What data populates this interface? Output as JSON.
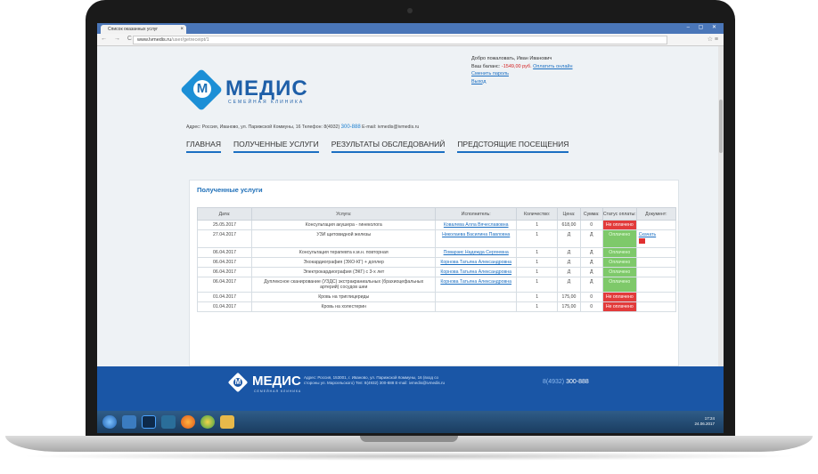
{
  "browser": {
    "tab_title": "Список оказанных услуг",
    "tab_close": "×",
    "url_host": "www.lvmedis.ru",
    "url_path": "/user/getreceipt/1"
  },
  "header": {
    "logo_letter": "М",
    "logo_name": "МЕДИС",
    "logo_sub": "СЕМЕЙНАЯ КЛИНИКА",
    "greeting": "Добро пожаловать, Иван Иванович",
    "balance_label": "Ваш баланс:",
    "balance_value": "-1549,00 руб.",
    "pay_online": "Оплатить онлайн",
    "change_password": "Сменить пароль",
    "logout": "Выход",
    "contact_text": "Адрес: Россия, Иваново, ул. Парижской Коммуны, 16 Телефон: 8(4932)",
    "contact_phone": "300-888",
    "contact_email": "E-mail: ivmedis@ivmedis.ru"
  },
  "menu": {
    "home": "ГЛАВНАЯ",
    "services": "ПОЛУЧЕННЫЕ УСЛУГИ",
    "results": "РЕЗУЛЬТАТЫ ОБСЛЕДОВАНИЙ",
    "visits": "ПРЕДСТОЯЩИЕ ПОСЕЩЕНИЯ"
  },
  "section": {
    "title": "Полученные услуги"
  },
  "table": {
    "headers": [
      "Дата:",
      "Услуга:",
      "Исполнитель:",
      "Количество:",
      "Цена:",
      "Сумма:",
      "Статус оплаты:",
      "Документ:"
    ],
    "rows": [
      {
        "date": "25.05.2017",
        "service": "Консультация акушера - гинеколога",
        "executor": "Ковалева Алла Вячеславовна",
        "qty": "1",
        "price": "618,00",
        "sum": "0",
        "status": "Не оплачено",
        "paid": false,
        "doc": ""
      },
      {
        "date": "27.04.2017",
        "service": "УЗИ щитовидной железы",
        "executor": "Николаева Василина Павловна",
        "qty": "1",
        "price": "Д",
        "sum": "Д",
        "status": "Оплачено",
        "paid": true,
        "doc": "Скачать"
      },
      {
        "date": "06.04.2017",
        "service": "Консультация терапевта к.м.н. повторная",
        "executor": "Поварзис Надежда Сергеевна",
        "qty": "1",
        "price": "Д",
        "sum": "Д",
        "status": "Оплачено",
        "paid": true,
        "doc": ""
      },
      {
        "date": "06.04.2017",
        "service": "Эхокардиография (ЭХО-КГ) + доплер",
        "executor": "Корнова Татьяна Александровна",
        "qty": "1",
        "price": "Д",
        "sum": "Д",
        "status": "Оплачено",
        "paid": true,
        "doc": ""
      },
      {
        "date": "06.04.2017",
        "service": "Электрокардиография (ЭКГ) с 3-х лет",
        "executor": "Корнова Татьяна Александровна",
        "qty": "1",
        "price": "Д",
        "sum": "Д",
        "status": "Оплачено",
        "paid": true,
        "doc": ""
      },
      {
        "date": "06.04.2017",
        "service": "Дуплексное сканирование (УЗДС) экстракраниальных (брахиоцефальных артерий) сосудов шеи",
        "executor": "Корнова Татьяна Александровна",
        "qty": "1",
        "price": "Д",
        "sum": "Д",
        "status": "Оплачено",
        "paid": true,
        "doc": ""
      },
      {
        "date": "01.04.2017",
        "service": "Кровь на триглицериды",
        "executor": "",
        "qty": "1",
        "price": "175,00",
        "sum": "0",
        "status": "Не оплачено",
        "paid": false,
        "doc": ""
      },
      {
        "date": "01.04.2017",
        "service": "Кровь на холестерин",
        "executor": "",
        "qty": "1",
        "price": "175,00",
        "sum": "0",
        "status": "Не оплачено",
        "paid": false,
        "doc": ""
      }
    ]
  },
  "footer": {
    "logo_name": "МЕДИС",
    "logo_sub": "СЕМЕЙНАЯ КЛИНИКА",
    "address": "Адрес: Россия, 153001, г. Иваново, ул. Парижской Коммуны, 16 (вход со стороны ул. Марсельского) Тел: 8(4932) 300-888 E-mail: ivmedis@ivmedis.ru",
    "phone_code": "8(4932)",
    "phone": "300-888"
  },
  "taskbar": {
    "time": "17:24",
    "date": "24.06.2017"
  },
  "colors": {
    "brand": "#1e5fa8",
    "paid": "#7ec96a",
    "unpaid": "#e23b3b",
    "footer": "#1a56a6"
  }
}
